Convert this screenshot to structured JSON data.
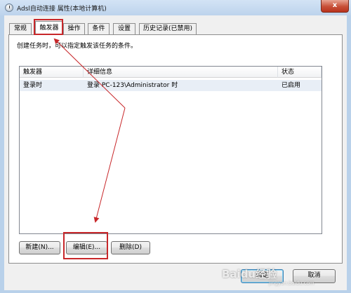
{
  "window": {
    "title": "Adsl自动连接 属性(本地计算机)",
    "close_label": "x"
  },
  "tabs": [
    {
      "label": "常规"
    },
    {
      "label": "触发器"
    },
    {
      "label": "操作"
    },
    {
      "label": "条件"
    },
    {
      "label": "设置"
    },
    {
      "label": "历史记录(已禁用)"
    }
  ],
  "active_tab": "触发器",
  "description": "创建任务时，可以指定触发该任务的条件。",
  "trigger_list": {
    "columns": [
      "触发器",
      "详细信息",
      "状态"
    ],
    "rows": [
      {
        "trigger": "登录时",
        "details": "登录 PC-123\\Administrator 时",
        "status": "已启用"
      }
    ]
  },
  "buttons": {
    "new": "新建(N)...",
    "edit": "编辑(E)...",
    "delete": "删除(D)",
    "ok": "确定",
    "cancel": "取消"
  },
  "watermark": {
    "text": "Baidu经验",
    "sub": "jingyan.baidu.com"
  },
  "colors": {
    "annotation": "#c8272a",
    "window_frame": "#b9d1ea",
    "selected_row": "#e8eef6"
  }
}
